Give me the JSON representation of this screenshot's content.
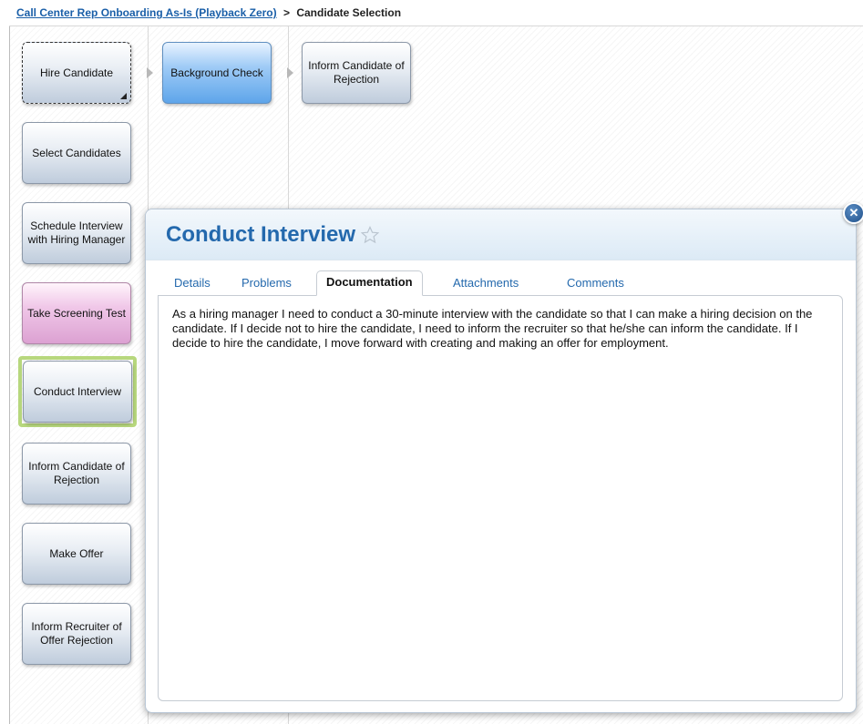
{
  "breadcrumb": {
    "parent_label": "Call Center Rep Onboarding As-Is (Playback Zero)",
    "separator": ">",
    "current": "Candidate Selection"
  },
  "lanes": {
    "col1": [
      "Hire Candidate",
      "Select Candidates",
      "Schedule Interview with Hiring Manager",
      "Take Screening Test",
      "Conduct Interview",
      "Inform Candidate of Rejection",
      "Make Offer",
      "Inform Recruiter of Offer Rejection"
    ],
    "col2": [
      "Background Check"
    ],
    "col3": [
      "Inform Candidate of Rejection"
    ]
  },
  "popup": {
    "title": "Conduct Interview",
    "close_glyph": "✕",
    "tabs": [
      "Details",
      "Problems",
      "Documentation",
      "Attachments",
      "Comments"
    ],
    "active_tab": "Documentation",
    "documentation_text": "As a hiring manager I need to conduct a 30-minute interview with the candidate so that I can make a hiring decision on the candidate. If I decide not to hire the candidate, I need to inform the recruiter so that he/she can inform the candidate. If I decide to hire the candidate, I move forward with creating and making an offer for employment."
  },
  "colors": {
    "link": "#1a5fa8",
    "title": "#2469ad",
    "highlight": "#b7d77d",
    "blue_box": "#5ea5ea",
    "pink_box": "#dca1d2"
  },
  "icons": {
    "favorite": "star-outline-icon",
    "close": "close-circle-icon",
    "flow_arrow": "triangle-right-icon",
    "subprocess_marker": "corner-triangle-icon"
  }
}
